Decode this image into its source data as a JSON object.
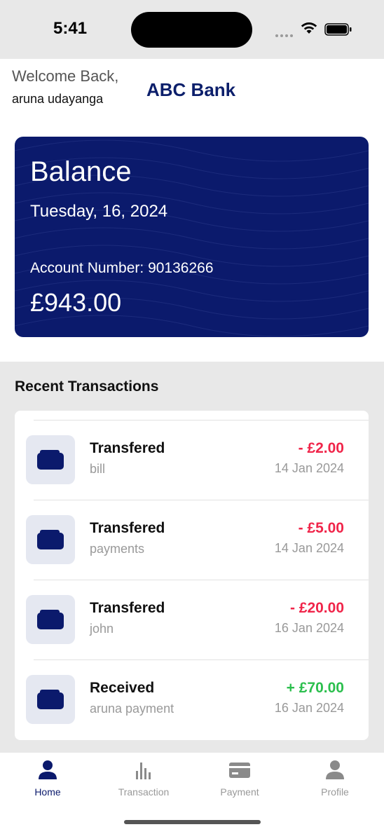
{
  "status_bar": {
    "time": "5:41"
  },
  "header": {
    "welcome": "Welcome Back,",
    "username": "aruna udayanga",
    "bank_name": "ABC Bank"
  },
  "balance_card": {
    "title": "Balance",
    "date": "Tuesday, 16, 2024",
    "account_number_line": "Account Number: 90136266",
    "amount": "£943.00"
  },
  "transactions": {
    "heading": "Recent Transactions",
    "items": [
      {
        "title": "Transfered",
        "subtitle": "bill",
        "amount": "- £2.00",
        "date": "14 Jan 2024",
        "type": "debit"
      },
      {
        "title": "Transfered",
        "subtitle": "payments",
        "amount": "- £5.00",
        "date": "14 Jan 2024",
        "type": "debit"
      },
      {
        "title": "Transfered",
        "subtitle": "john",
        "amount": "- £20.00",
        "date": "16 Jan 2024",
        "type": "debit"
      },
      {
        "title": "Received",
        "subtitle": "aruna payment",
        "amount": "+ £70.00",
        "date": "16 Jan 2024",
        "type": "credit"
      }
    ]
  },
  "nav": {
    "items": [
      {
        "label": "Home",
        "icon": "person-icon",
        "active": true
      },
      {
        "label": "Transaction",
        "icon": "bar-chart-icon",
        "active": false
      },
      {
        "label": "Payment",
        "icon": "credit-card-icon",
        "active": false
      },
      {
        "label": "Profile",
        "icon": "person-icon",
        "active": false
      }
    ]
  },
  "colors": {
    "brand": "#0b1a6c",
    "debit": "#f0254a",
    "credit": "#2cbf4e",
    "muted": "#999999",
    "section_bg": "#e8e8e8"
  }
}
